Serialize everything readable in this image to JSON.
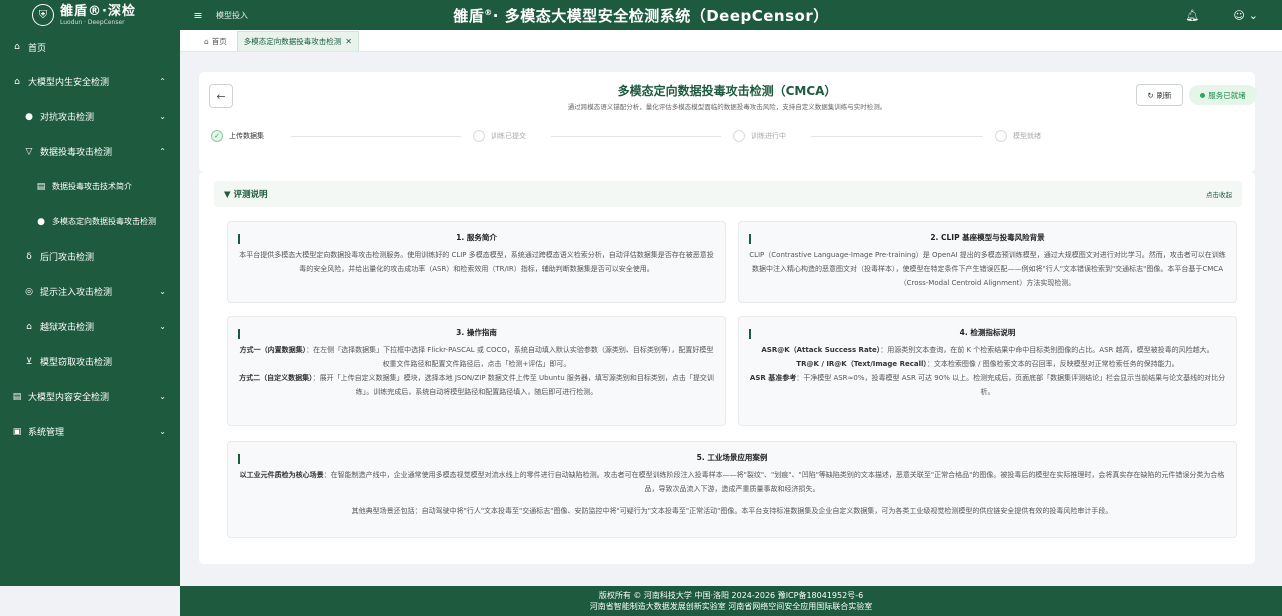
{
  "header": {
    "brand_cn": "雒盾®·深检",
    "brand_en": "Luodun · DeepCenser",
    "logo_icon": "shield-logo-icon",
    "breadcrumb": "模型投入",
    "system_title": "雒盾",
    "system_title_sup": "®",
    "system_title_rest": "· 多模态大模型安全检测系统（DeepCensor）",
    "accent_color": "#1e5a3e"
  },
  "sidebar": {
    "items": [
      {
        "label": "首页",
        "icon": "home-icon",
        "glyph": "⌂",
        "arrow": "",
        "level": 1
      },
      {
        "label": "大模型内生安全检测",
        "icon": "shield-icon",
        "glyph": "⌂",
        "arrow": "⌃",
        "level": 1
      },
      {
        "label": "对抗攻击检测",
        "icon": "dot-icon",
        "glyph": "●",
        "arrow": "⌄",
        "level": 2
      },
      {
        "label": "数据投毒攻击检测",
        "icon": "flask-icon",
        "glyph": "▽",
        "arrow": "⌃",
        "level": 2
      },
      {
        "label": "数据投毒攻击技术简介",
        "icon": "doc-icon",
        "glyph": "▤",
        "arrow": "",
        "level": 3
      },
      {
        "label": "多模态定向数据投毒攻击检测",
        "icon": "dot-icon",
        "glyph": "●",
        "arrow": "",
        "level": 3
      },
      {
        "label": "后门攻击检测",
        "icon": "backdoor-icon",
        "glyph": "δ",
        "arrow": "",
        "level": 2
      },
      {
        "label": "提示注入攻击检测",
        "icon": "prompt-icon",
        "glyph": "◎",
        "arrow": "⌄",
        "level": 2
      },
      {
        "label": "越狱攻击检测",
        "icon": "lock-icon",
        "glyph": "⌂",
        "arrow": "⌄",
        "level": 2
      },
      {
        "label": "模型窃取攻击检测",
        "icon": "download-icon",
        "glyph": "⊻",
        "arrow": "",
        "level": 2
      },
      {
        "label": "大模型内容安全检测",
        "icon": "document-icon",
        "glyph": "▤",
        "arrow": "⌄",
        "level": 1
      },
      {
        "label": "系统管理",
        "icon": "settings-icon",
        "glyph": "▣",
        "arrow": "⌄",
        "level": 1
      }
    ]
  },
  "tabs": [
    {
      "label": "首页",
      "icon": "home-icon",
      "active": false
    },
    {
      "label": "多模态定向数据投毒攻击检测",
      "icon": "close-icon",
      "active": true
    }
  ],
  "page": {
    "title": "多模态定向数据投毒攻击检测（CMCA）",
    "subtitle": "通过跨模态语义锚配分析，量化评估多模态模型面临的数据投毒攻击风险，支持自定义数据集训练与实时检测。",
    "refresh_label": "刷新",
    "status_label": "服务已就绪",
    "status_color": "#2aa85a",
    "steps": [
      {
        "label": "上传数据集",
        "state": "done"
      },
      {
        "label": "训练已提交",
        "state": "pending"
      },
      {
        "label": "训练进行中",
        "state": "pending"
      },
      {
        "label": "模型就绪",
        "state": "pending"
      }
    ]
  },
  "section": {
    "title": "▼ 评测说明",
    "hint": "点击收起",
    "boxes": [
      {
        "title": "1. 服务简介",
        "body": "本平台提供多模态大模型定向数据投毒攻击检测服务。使用训练好的 CLIP 多模态模型，系统通过跨模态语义检索分析，自动评估数据集是否存在被恶意投毒的安全风险，并给出量化的攻击成功率（ASR）和检索效用（TR/IR）指标，辅助判断数据集是否可以安全使用。"
      },
      {
        "title": "2. CLIP 基座模型与投毒风险背景",
        "body": "CLIP（Contrastive Language-Image Pre-training）是 OpenAI 提出的多模态预训练模型，通过大规模图文对进行对比学习。然而，攻击者可以在训练数据中注入精心构造的恶意图文对（投毒样本），使模型在特定条件下产生错误匹配——例如将\"行人\"文本错误检索到\"交通标志\"图像。本平台基于CMCA（Cross-Modal Centroid Alignment）方法实现检测。"
      },
      {
        "title": "3. 操作指南",
        "p1_label": "方式一（内置数据集）",
        "p1": "：在左侧「选择数据集」下拉框中选择 Flickr-PASCAL 或 COCO，系统自动填入默认实验参数（源类别、目标类别等），配置好模型权重文件路径和配置文件路径后，点击「检测+评估」即可。",
        "p2_label": "方式二（自定义数据集）",
        "p2": "：展开「上传自定义数据集」模块，选择本地 JSON/ZIP 数据文件上传至 Ubuntu 服务器，填写源类别和目标类别，点击「提交训练」。训练完成后，系统自动将模型路径和配置路径填入，随后即可进行检测。"
      },
      {
        "title": "4. 检测指标说明",
        "p1_label": "ASR@K（Attack Success Rate）",
        "p1": "：用源类别文本查询，在前 K 个检索结果中命中目标类别图像的占比。ASR 越高，模型被投毒的风险越大。",
        "p2_label": "TR@K / IR@K（Text/Image Recall）",
        "p2": "：文本检索图像 / 图像检索文本的召回率，反映模型对正常检索任务的保持能力。",
        "p3_label": "ASR 基准参考",
        "p3": "：干净模型 ASR≈0%，投毒模型 ASR 可达 90% 以上。检测完成后，页面底部「数据集评测结论」栏会显示当前结果与论文基线的对比分析。"
      },
      {
        "title": "5. 工业场景应用案例",
        "p1_label": "以工业元件质检为核心场景",
        "p1": "：在智能制造产线中，企业通常使用多模态视觉模型对流水线上的零件进行自动缺陷检测。攻击者可在模型训练阶段注入投毒样本——将\"裂纹\"、\"划痕\"、\"凹陷\"等缺陷类别的文本描述，恶意关联至\"正常合格品\"的图像。被投毒后的模型在实际推理时，会将真实存在缺陷的元件错误分类为合格品，导致次品流入下游，造成严重质量事故和经济损失。",
        "p2": "其他典型场景还包括：自动驾驶中将\"行人\"文本投毒至\"交通标志\"图像、安防监控中将\"可疑行为\"文本投毒至\"正常活动\"图像。本平台支持标准数据集及企业自定义数据集，可为各类工业级视觉检测模型的供应链安全提供有效的投毒风险审计手段。"
      }
    ]
  },
  "footer": {
    "line1": "版权所有 © 河南科技大学  中国·洛阳  2024-2026     豫ICP备18041952号-6",
    "line2": "河南省智能制造大数据发展创新实验室  河南省网络空间安全应用国际联合实验室"
  }
}
